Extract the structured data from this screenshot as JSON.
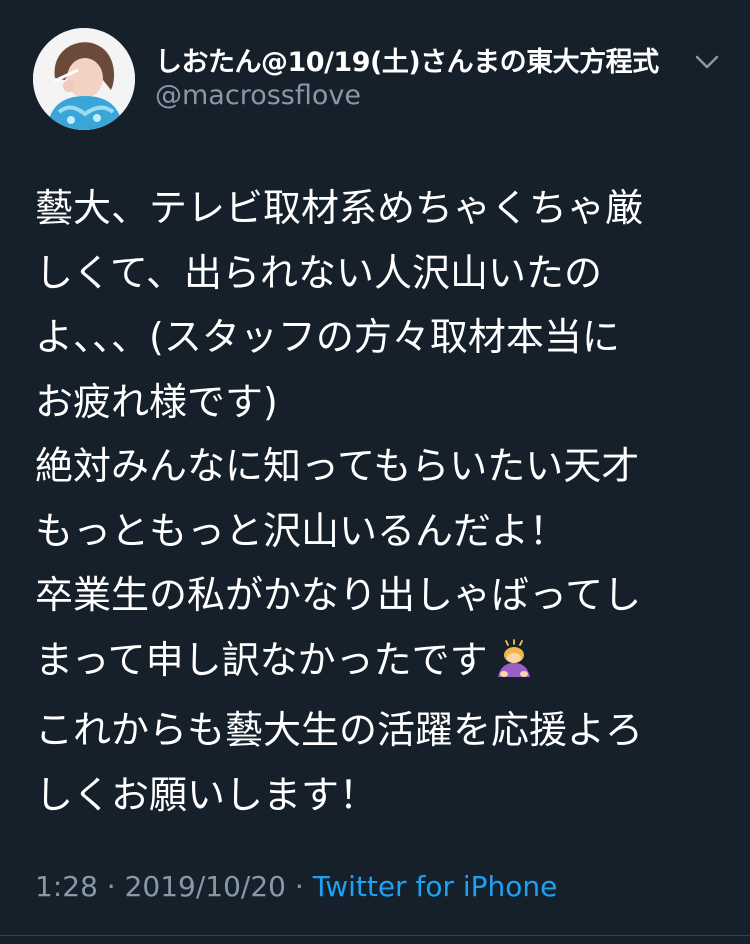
{
  "tweet": {
    "display_name": "しおたん@10/19(土)さんまの東大方程式",
    "handle": "@macrossflove",
    "body_lines": [
      "藝大、テレビ取材系めちゃくちゃ厳",
      "しくて、出られない人沢山いたの",
      "よ、、、(スタッフの方々取材本当に",
      "お疲れ様です)",
      "絶対みんなに知ってもらいたい天才",
      "もっともっと沢山いるんだよ！",
      "卒業生の私がかなり出しゃばってし",
      "まって申し訳なかったです",
      "これからも藝大生の活躍を応援よろ",
      "しくお願いします！"
    ],
    "emoji": "person-bowing-emoji",
    "time": "1:28",
    "date": "2019/10/20",
    "separator": "·",
    "source": "Twitter for iPhone"
  },
  "icons": {
    "more": "chevron-down-icon",
    "avatar": "avatar"
  },
  "colors": {
    "background": "#15202b",
    "text": "#ffffff",
    "secondary": "#8899a6",
    "link": "#1da1f2",
    "divider": "#38444d"
  }
}
